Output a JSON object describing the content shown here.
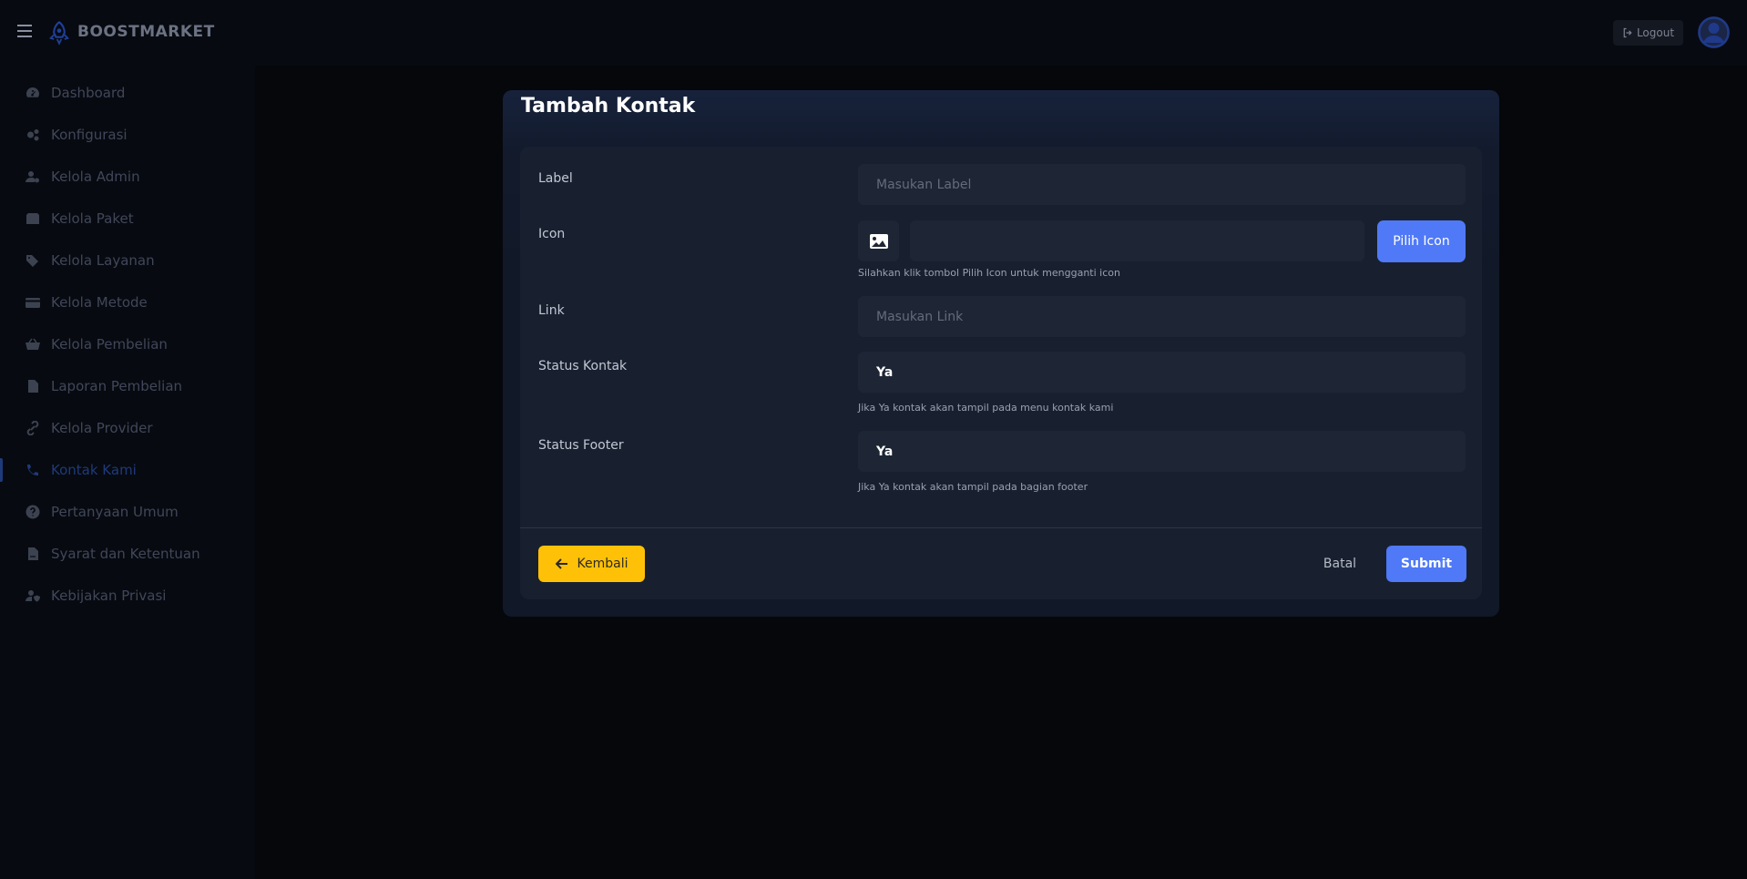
{
  "app": {
    "brand": "BOOSTMARKET",
    "logout_label": "Logout"
  },
  "sidebar": {
    "items": [
      {
        "label": "Dashboard",
        "icon": "dashboard-icon"
      },
      {
        "label": "Konfigurasi",
        "icon": "gears-icon"
      },
      {
        "label": "Kelola Admin",
        "icon": "user-gear-icon"
      },
      {
        "label": "Kelola Paket",
        "icon": "box-icon"
      },
      {
        "label": "Kelola Layanan",
        "icon": "tags-icon"
      },
      {
        "label": "Kelola Metode",
        "icon": "credit-card-icon"
      },
      {
        "label": "Kelola Pembelian",
        "icon": "basket-icon"
      },
      {
        "label": "Laporan Pembelian",
        "icon": "file-icon"
      },
      {
        "label": "Kelola Provider",
        "icon": "link-icon"
      },
      {
        "label": "Kontak Kami",
        "icon": "phone-icon",
        "active": true
      },
      {
        "label": "Pertanyaan Umum",
        "icon": "question-icon"
      },
      {
        "label": "Syarat dan Ketentuan",
        "icon": "file-contract-icon"
      },
      {
        "label": "Kebijakan Privasi",
        "icon": "user-shield-icon"
      }
    ]
  },
  "modal": {
    "title": "Tambah Kontak",
    "fields": {
      "label": {
        "label": "Label",
        "placeholder": "Masukan Label"
      },
      "icon": {
        "label": "Icon",
        "button": "Pilih Icon",
        "help": "Silahkan klik tombol Pilih Icon untuk mengganti icon"
      },
      "link": {
        "label": "Link",
        "placeholder": "Masukan Link"
      },
      "status_kontak": {
        "label": "Status Kontak",
        "value": "Ya",
        "help": "Jika Ya kontak akan tampil pada menu kontak kami"
      },
      "status_footer": {
        "label": "Status Footer",
        "value": "Ya",
        "help": "Jika Ya kontak akan tampil pada bagian footer"
      }
    },
    "actions": {
      "back": "Kembali",
      "cancel": "Batal",
      "submit": "Submit"
    }
  },
  "colors": {
    "accent": "#4f79f7",
    "warning": "#ffc107",
    "background": "#05070b",
    "panel": "#111827"
  }
}
